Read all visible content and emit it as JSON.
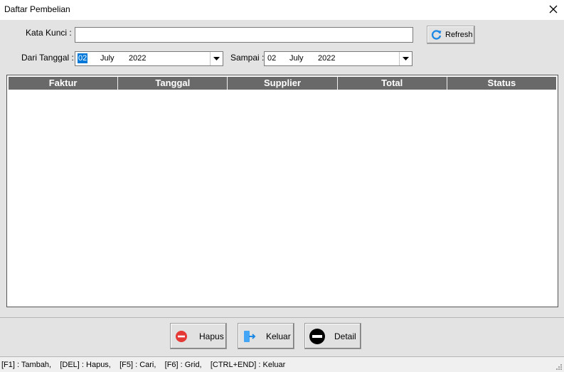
{
  "window": {
    "title": "Daftar Pembelian"
  },
  "form": {
    "keyword_label": "Kata Kunci :",
    "keyword_value": "",
    "refresh_label": "Refresh",
    "from_label": "Dari Tanggal :",
    "from_date": {
      "day": "02",
      "month": "July",
      "year": "2022"
    },
    "to_label": "Sampai :",
    "to_date": {
      "day": "02",
      "month": "July",
      "year": "2022"
    }
  },
  "grid": {
    "columns": [
      "Faktur",
      "Tanggal",
      "Supplier",
      "Total",
      "Status"
    ],
    "rows": []
  },
  "buttons": {
    "hapus": "Hapus",
    "keluar": "Keluar",
    "detail": "Detail"
  },
  "statusbar": {
    "text": "[F1] : Tambah,    [DEL] : Hapus,    [F5] : Cari,    [F6] : Grid,    [CTRL+END] : Keluar"
  },
  "colors": {
    "grid_header": "#696969",
    "refresh_icon": "#1e88e5",
    "hapus_icon": "#e53935",
    "keluar_icon": "#42a5f5"
  }
}
